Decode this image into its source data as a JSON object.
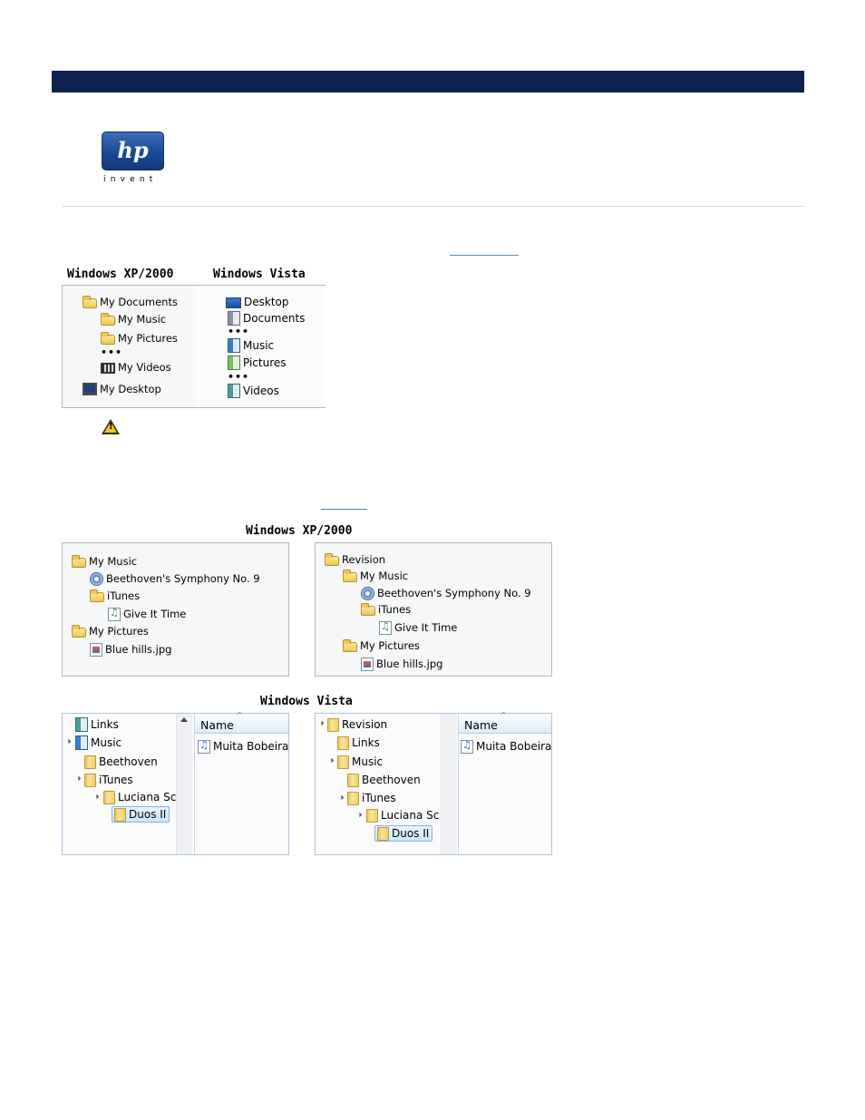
{
  "header": {
    "logo_text": "hp",
    "logo_tagline": "invent"
  },
  "figure1": {
    "col_xp": "Windows XP/2000",
    "col_vista": "Windows Vista",
    "xp_items": [
      "My Documents",
      "My Music",
      "My Pictures",
      "My Videos",
      "My Desktop"
    ],
    "vista_items": [
      "Desktop",
      "Documents",
      "Music",
      "Pictures",
      "Videos"
    ],
    "ellipsis": "•••"
  },
  "figure2": {
    "title": "Windows XP/2000",
    "left_tree": [
      "My Music",
      "Beethoven's Symphony No. 9",
      "iTunes",
      "Give It Time",
      "My Pictures",
      "Blue hills.jpg"
    ],
    "right_tree": [
      "Revision",
      "My Music",
      "Beethoven's Symphony No. 9",
      "iTunes",
      "Give It Time",
      "My Pictures",
      "Blue hills.jpg"
    ]
  },
  "figure3": {
    "title": "Windows Vista",
    "left_tree": [
      "Links",
      "Music",
      "Beethoven",
      "iTunes",
      "Luciana Sc",
      "Duos II"
    ],
    "right_tree": [
      "Revision",
      "Links",
      "Music",
      "Beethoven",
      "iTunes",
      "Luciana Sc",
      "Duos II"
    ],
    "column_name": "Name",
    "file_name": "Muita Bobeira"
  }
}
